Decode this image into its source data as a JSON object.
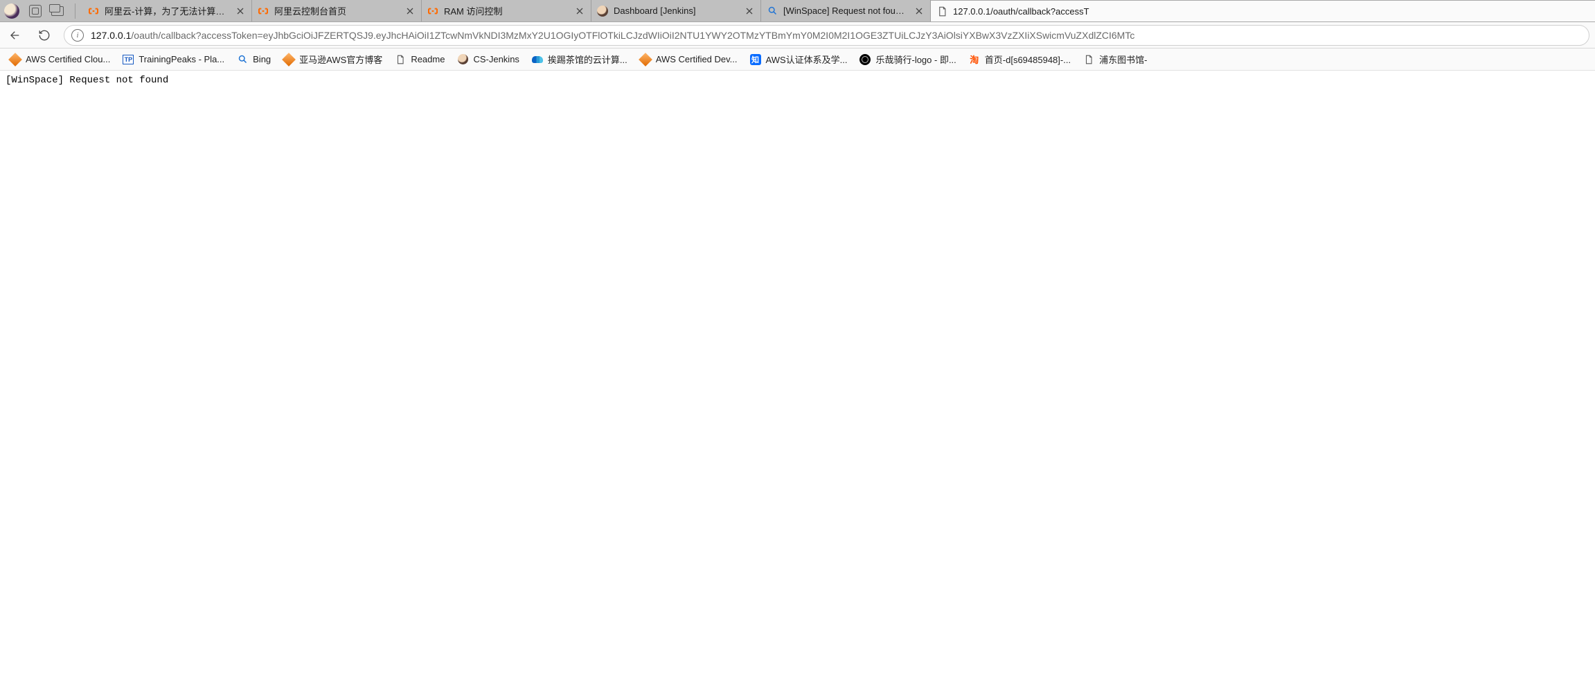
{
  "tabs": [
    {
      "title": "阿里云-计算，为了无法计算的价",
      "favicon": "aliyun"
    },
    {
      "title": "阿里云控制台首页",
      "favicon": "aliyun"
    },
    {
      "title": "RAM 访问控制",
      "favicon": "aliyun"
    },
    {
      "title": "Dashboard [Jenkins]",
      "favicon": "jenkins"
    },
    {
      "title": "[WinSpace] Request not found -",
      "favicon": "search"
    },
    {
      "title": "127.0.0.1/oauth/callback?accessT",
      "favicon": "file",
      "active": true
    }
  ],
  "address": {
    "host": "127.0.0.1",
    "path": "/oauth/callback?accessToken=eyJhbGciOiJFZERTQSJ9.eyJhcHAiOiI1ZTcwNmVkNDI3MzMxY2U1OGIyOTFlOTkiLCJzdWIiOiI2NTU1YWY2OTMzYTBmYmY0M2I0M2I1OGE3ZTUiLCJzY3AiOlsiYXBwX3VzZXIiXSwicmVuZXdlZCI6MTc"
  },
  "bookmarks": [
    {
      "label": "AWS Certified Clou...",
      "icon": "aws"
    },
    {
      "label": "TrainingPeaks - Pla...",
      "icon": "tp"
    },
    {
      "label": "Bing",
      "icon": "bing"
    },
    {
      "label": "亚马逊AWS官方博客",
      "icon": "aws"
    },
    {
      "label": "Readme",
      "icon": "doc"
    },
    {
      "label": "CS-Jenkins",
      "icon": "jenkins"
    },
    {
      "label": "挨踢茶馆的云计算...",
      "icon": "onedrive"
    },
    {
      "label": "AWS Certified Dev...",
      "icon": "aws"
    },
    {
      "label": "AWS认证体系及学...",
      "icon": "zhihu"
    },
    {
      "label": "乐哉骑行-logo - 即...",
      "icon": "dark"
    },
    {
      "label": "首页-d[s69485948]-...",
      "icon": "taobao"
    },
    {
      "label": "浦东图书馆-",
      "icon": "doc"
    }
  ],
  "page": {
    "body_text": "[WinSpace] Request not found"
  },
  "zhihu_glyph": "知",
  "taobao_glyph": "淘",
  "tp_glyph": "TP"
}
